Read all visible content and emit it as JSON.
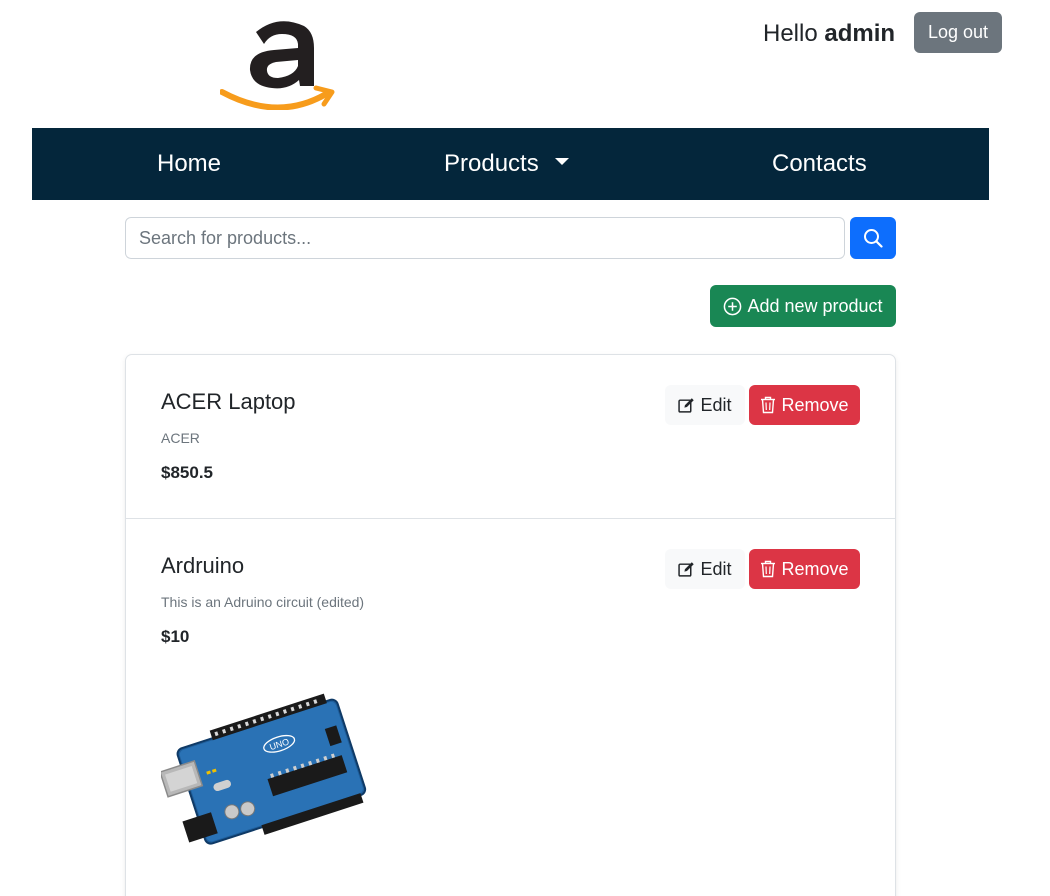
{
  "header": {
    "logo_icon": "amazon-logo-icon",
    "greeting_prefix": "Hello",
    "username": "admin",
    "logout_label": "Log out"
  },
  "nav": {
    "home": "Home",
    "products": "Products",
    "contacts": "Contacts",
    "background": "#04263b"
  },
  "search": {
    "placeholder": "Search for products...",
    "value": "",
    "icon": "search-icon"
  },
  "actions": {
    "add_label": "Add new product",
    "add_icon": "plus-circle-icon"
  },
  "products": [
    {
      "name": "ACER Laptop",
      "description": "ACER",
      "price": "$850.5",
      "edit_label": "Edit",
      "remove_label": "Remove"
    },
    {
      "name": "Ardruino",
      "description": "This is an Adruino circuit (edited)",
      "price": "$10",
      "edit_label": "Edit",
      "remove_label": "Remove",
      "image_icon": "arduino-board-image",
      "board_text": "UNO"
    }
  ],
  "colors": {
    "primary": "#0d6efd",
    "success": "#198754",
    "danger": "#dc3545",
    "secondary": "#6c757d",
    "logo_orange": "#f79c1c"
  }
}
